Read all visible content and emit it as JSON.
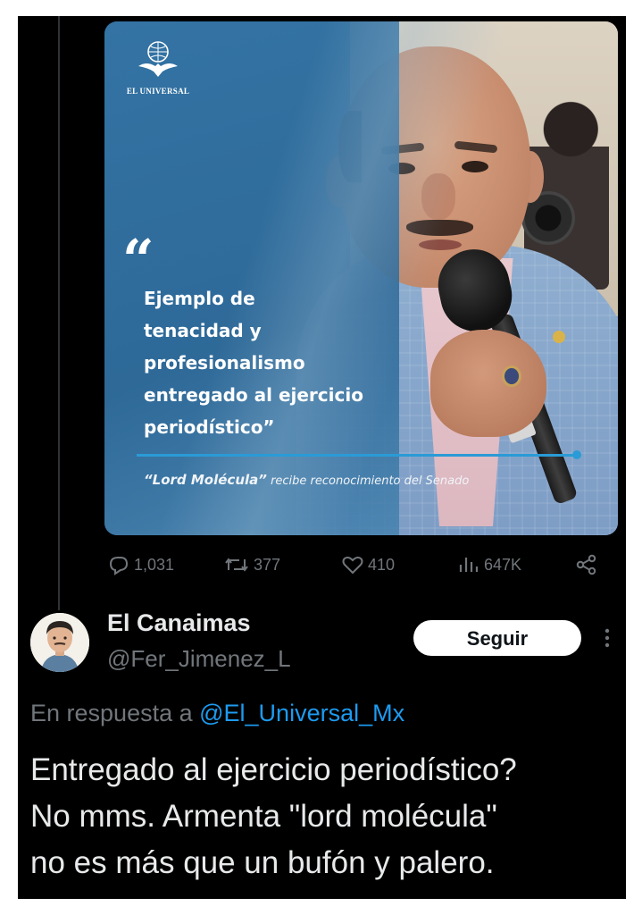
{
  "original_post": {
    "image": {
      "brand": "EL UNIVERSAL",
      "quote": "Ejemplo de\ntenacidad y\nprofesionalismo\nentregado al ejercicio\nperiodístico”",
      "caption_name": "“Lord Molécula”",
      "caption_rest": " recibe reconocimiento del Senado"
    },
    "metrics": {
      "replies": "1,031",
      "reposts": "377",
      "likes": "410",
      "views": "647K"
    }
  },
  "reply": {
    "display_name": "El Canaimas",
    "handle": "@Fer_Jimenez_L",
    "follow_label": "Seguir",
    "in_reply_prefix": "En respuesta a ",
    "in_reply_mention": "@El_Universal_Mx",
    "text": "Entregado al ejercicio periodístico?\nNo mms. Armenta \"lord molécula\"\nno es más que un bufón y palero."
  },
  "icons": {
    "reply": "reply-icon",
    "repost": "repost-icon",
    "like": "heart-icon",
    "views": "views-icon",
    "share": "share-icon",
    "more": "more-icon"
  },
  "colors": {
    "background": "#000000",
    "text_primary": "#e7e9ea",
    "text_secondary": "#71767b",
    "link": "#1d9bf0"
  }
}
